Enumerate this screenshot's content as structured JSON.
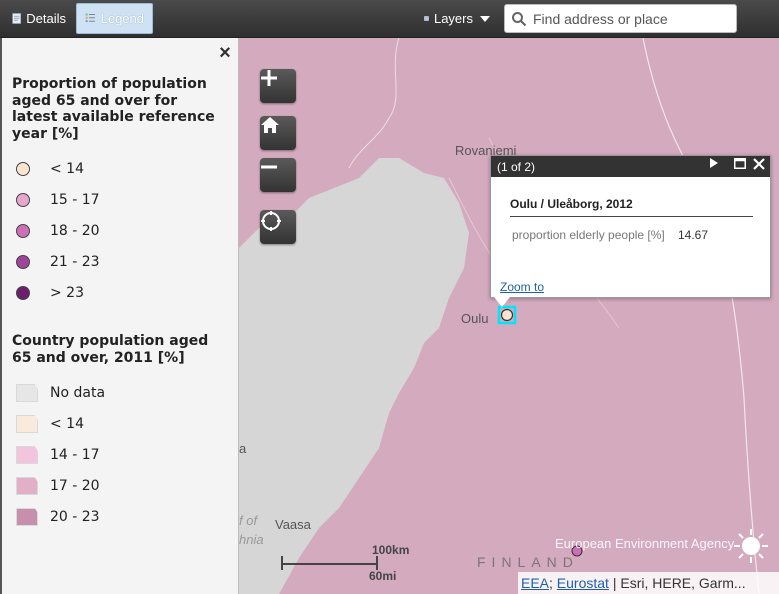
{
  "toolbar": {
    "details_label": "Details",
    "legend_label": "Legend",
    "layers_label": "Layers",
    "search_placeholder": "Find address or place"
  },
  "legend": {
    "section1_title": "Proportion of population aged 65 and over for latest available reference year [%]",
    "section1_items": [
      {
        "label": "< 14",
        "color": "#fbe5d0"
      },
      {
        "label": "15 - 17",
        "color": "#e8a6cc"
      },
      {
        "label": "18 - 20",
        "color": "#cc6fb6"
      },
      {
        "label": "21 - 23",
        "color": "#a0449b"
      },
      {
        "label": "> 23",
        "color": "#6d1f6e"
      }
    ],
    "section2_title": "Country population aged 65 and over, 2011 [%]",
    "section2_items": [
      {
        "label": "No data",
        "color": "#e6e6e6"
      },
      {
        "label": "< 14",
        "color": "#f9eadb"
      },
      {
        "label": "14 - 17",
        "color": "#f3c4dd"
      },
      {
        "label": "17 - 20",
        "color": "#e1b0c6"
      },
      {
        "label": "20 - 23",
        "color": "#c78fae"
      }
    ]
  },
  "map": {
    "places": {
      "rovaniemi": "Rovaniemi",
      "oulu": "Oulu",
      "vaasa": "Vaasa",
      "finland": "FINLAND",
      "a_fragment": "a",
      "gulf1": "f of",
      "gulf2": "hnia"
    },
    "scale": {
      "km": "100km",
      "mi": "60mi"
    },
    "watermark": "European Environment Agency",
    "attribution": {
      "eea": "EEA",
      "sep1": ";",
      "eurostat": "Eurostat",
      "rest": " | Esri, HERE, Garm..."
    }
  },
  "popup": {
    "counter": "(1 of 2)",
    "title": "Oulu / Uleåborg, 2012",
    "attribute_label": "proportion elderly people [%]",
    "attribute_value": "14.67",
    "zoom_label": "Zoom to"
  },
  "colors": {
    "land": "#d4aabe",
    "sea": "#d4d4d4",
    "selection": "#00e5ff"
  }
}
